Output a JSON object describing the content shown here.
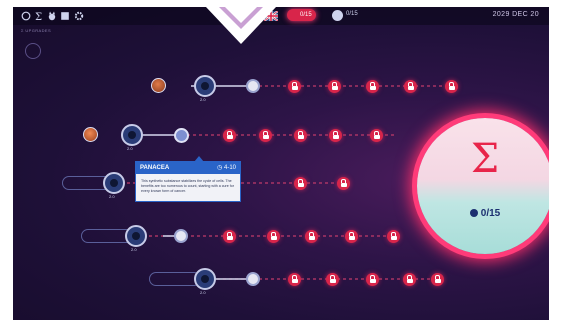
{
  "topbar": {
    "icons": [
      "globe-icon",
      "sigma-icon",
      "cat-icon",
      "block-icon",
      "gear-icon"
    ],
    "flag_icon": "uk-flag-icon",
    "locked_count": "0/15",
    "owned_count": "0/15",
    "date": "2029 DEC 20"
  },
  "screen": {
    "subtitle": "Σ UPGRADES",
    "sigma_symbol": "Σ",
    "progress": "0/15"
  },
  "tooltip": {
    "title": "PANACEA",
    "range": "4-10",
    "text": "This synthetic substance stabilizes the cycle of cells. The benefits are too numerous to count, starting with a cure for every known form of cancer."
  },
  "colors": {
    "locked": "#d8254a",
    "accent_blue": "#2a64c8",
    "glow": "#ff3b79"
  }
}
